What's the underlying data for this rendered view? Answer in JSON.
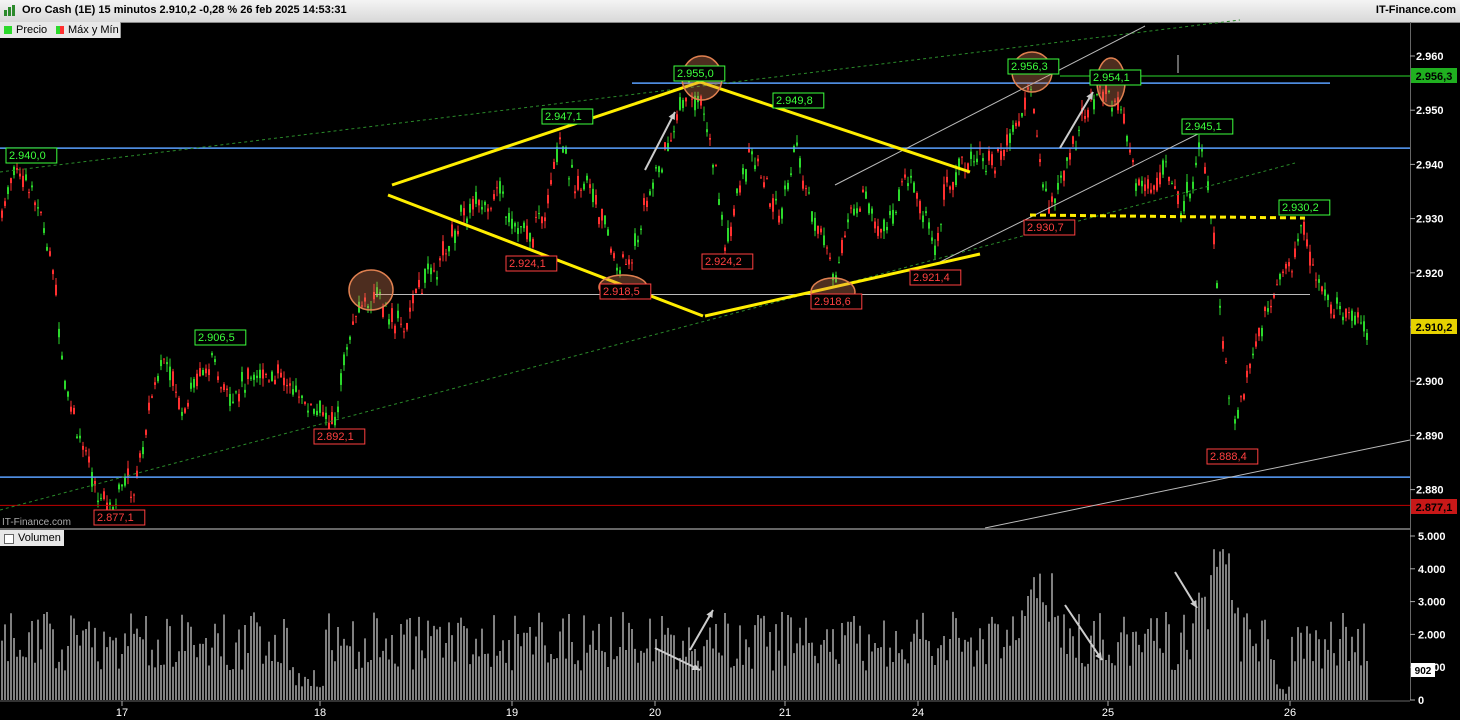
{
  "header": {
    "title": "Oro Cash (1E) 15 minutos 2.910,2 -0,28 % 26 feb 2025 14:53:31",
    "brand": "IT-Finance.com"
  },
  "legend": {
    "price": "Precio",
    "maxmin": "Máx y Mín"
  },
  "volume_legend": "Volumen",
  "watermark": "IT-Finance.com",
  "colors": {
    "up": "#2bd92b",
    "down": "#ff3030",
    "trend": "#ffee00",
    "support": "#5aa0ff",
    "channel": "#2a8a2a"
  },
  "chart_data": [
    {
      "type": "candlestick",
      "ylim": [
        2874,
        2966
      ],
      "y_ticks": [
        "2.960",
        "2.950",
        "2.940",
        "2.930",
        "2.920",
        "2.910",
        "2.900",
        "2.890",
        "2.880"
      ],
      "x_ticks": [
        "17",
        "18",
        "19",
        "20",
        "21",
        "24",
        "25",
        "26"
      ],
      "last_price": "2.910,2",
      "price_flags": [
        {
          "label": "2.956,3",
          "kind": "high"
        },
        {
          "label": "2.877,1",
          "kind": "low"
        }
      ],
      "pivot_labels": [
        {
          "text": "2.940,0",
          "kind": "high"
        },
        {
          "text": "2.906,5",
          "kind": "high"
        },
        {
          "text": "2.947,1",
          "kind": "high"
        },
        {
          "text": "2.955,0",
          "kind": "high"
        },
        {
          "text": "2.949,8",
          "kind": "high"
        },
        {
          "text": "2.956,3",
          "kind": "high"
        },
        {
          "text": "2.954,1",
          "kind": "high"
        },
        {
          "text": "2.945,1",
          "kind": "high"
        },
        {
          "text": "2.930,2",
          "kind": "high"
        },
        {
          "text": "2.877,1",
          "kind": "low"
        },
        {
          "text": "2.892,1",
          "kind": "low"
        },
        {
          "text": "2.924,1",
          "kind": "low"
        },
        {
          "text": "2.918,5",
          "kind": "low"
        },
        {
          "text": "2.924,2",
          "kind": "low"
        },
        {
          "text": "2.918,6",
          "kind": "low"
        },
        {
          "text": "2.921,4",
          "kind": "low"
        },
        {
          "text": "2.930,7",
          "kind": "low"
        },
        {
          "text": "2.888,4",
          "kind": "low"
        }
      ],
      "horizontal_levels": [
        2955.0,
        2943.0,
        2882.3,
        2877.1,
        2916.0
      ],
      "path_points": [
        [
          0,
          2930
        ],
        [
          15,
          2940
        ],
        [
          30,
          2936
        ],
        [
          45,
          2928
        ],
        [
          55,
          2918
        ],
        [
          65,
          2900
        ],
        [
          80,
          2890
        ],
        [
          95,
          2880
        ],
        [
          110,
          2877.1
        ],
        [
          125,
          2882
        ],
        [
          135,
          2880
        ],
        [
          150,
          2895
        ],
        [
          165,
          2906.5
        ],
        [
          180,
          2895
        ],
        [
          195,
          2900
        ],
        [
          210,
          2903
        ],
        [
          230,
          2898
        ],
        [
          250,
          2900
        ],
        [
          270,
          2902
        ],
        [
          295,
          2898
        ],
        [
          320,
          2894
        ],
        [
          335,
          2892.1
        ],
        [
          345,
          2905
        ],
        [
          360,
          2914
        ],
        [
          375,
          2916
        ],
        [
          390,
          2912
        ],
        [
          405,
          2910
        ],
        [
          420,
          2918
        ],
        [
          440,
          2922
        ],
        [
          460,
          2930
        ],
        [
          480,
          2933
        ],
        [
          500,
          2935
        ],
        [
          515,
          2929
        ],
        [
          530,
          2926
        ],
        [
          545,
          2932
        ],
        [
          560,
          2946
        ],
        [
          575,
          2935
        ],
        [
          590,
          2937
        ],
        [
          605,
          2928
        ],
        [
          620,
          2920
        ],
        [
          635,
          2925
        ],
        [
          650,
          2935
        ],
        [
          665,
          2942
        ],
        [
          680,
          2950
        ],
        [
          690,
          2955.0
        ],
        [
          705,
          2948
        ],
        [
          715,
          2940
        ],
        [
          725,
          2925
        ],
        [
          735,
          2932
        ],
        [
          750,
          2942
        ],
        [
          765,
          2936
        ],
        [
          780,
          2930
        ],
        [
          795,
          2944
        ],
        [
          805,
          2935
        ],
        [
          820,
          2928
        ],
        [
          835,
          2920
        ],
        [
          850,
          2930
        ],
        [
          865,
          2935
        ],
        [
          880,
          2928
        ],
        [
          895,
          2932
        ],
        [
          910,
          2938
        ],
        [
          925,
          2930
        ],
        [
          935,
          2924
        ],
        [
          945,
          2935
        ],
        [
          960,
          2940
        ],
        [
          980,
          2942
        ],
        [
          995,
          2940
        ],
        [
          1010,
          2945
        ],
        [
          1025,
          2950
        ],
        [
          1030,
          2956.3
        ],
        [
          1040,
          2940
        ],
        [
          1050,
          2932
        ],
        [
          1060,
          2936
        ],
        [
          1070,
          2942
        ],
        [
          1080,
          2948
        ],
        [
          1095,
          2952
        ],
        [
          1105,
          2954.1
        ],
        [
          1120,
          2950
        ],
        [
          1135,
          2938
        ],
        [
          1150,
          2935
        ],
        [
          1165,
          2940
        ],
        [
          1180,
          2932
        ],
        [
          1190,
          2935
        ],
        [
          1200,
          2945.1
        ],
        [
          1210,
          2935
        ],
        [
          1218,
          2915
        ],
        [
          1225,
          2905
        ],
        [
          1232,
          2888.4
        ],
        [
          1240,
          2895
        ],
        [
          1250,
          2905
        ],
        [
          1265,
          2912
        ],
        [
          1280,
          2918
        ],
        [
          1295,
          2922
        ],
        [
          1300,
          2930.2
        ],
        [
          1315,
          2918
        ],
        [
          1330,
          2915
        ],
        [
          1345,
          2912
        ],
        [
          1360,
          2912
        ],
        [
          1368,
          2910.2
        ]
      ]
    },
    {
      "type": "bar",
      "name": "Volumen",
      "ylim": [
        0,
        5200
      ],
      "y_ticks": [
        "5.000",
        "4.000",
        "3.000",
        "2.000",
        "1.000",
        "0"
      ],
      "last_volume": "902"
    }
  ]
}
